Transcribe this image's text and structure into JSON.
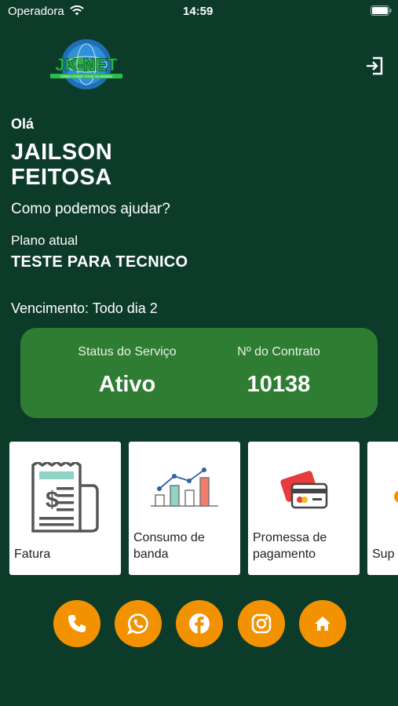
{
  "status_bar": {
    "carrier": "Operadora",
    "time": "14:59"
  },
  "brand": {
    "logo_text": "JK-NET",
    "logo_tagline": "CONECTANDO VOCÊ AO MUNDO"
  },
  "greeting": {
    "hello": "Olá",
    "name": "JAILSON FEITOSA",
    "help": "Como podemos ajudar?"
  },
  "plan": {
    "label": "Plano atual",
    "name": "TESTE PARA TECNICO"
  },
  "due_date": "Vencimento: Todo dia 2",
  "service_card": {
    "status_label": "Status do Serviço",
    "status_value": "Ativo",
    "contract_label": "Nº do Contrato",
    "contract_value": "10138"
  },
  "menu": [
    {
      "label": "Fatura",
      "icon": "invoice-icon"
    },
    {
      "label": "Consumo de banda",
      "icon": "bandwidth-chart-icon"
    },
    {
      "label": "Promessa de pagamento",
      "icon": "credit-card-icon"
    },
    {
      "label": "Sup",
      "icon": "support-icon"
    }
  ],
  "social": [
    {
      "name": "phone",
      "icon": "phone-icon"
    },
    {
      "name": "whatsapp",
      "icon": "whatsapp-icon"
    },
    {
      "name": "facebook",
      "icon": "facebook-icon"
    },
    {
      "name": "instagram",
      "icon": "instagram-icon"
    },
    {
      "name": "home",
      "icon": "home-icon"
    }
  ],
  "colors": {
    "background": "#0d3b2a",
    "card": "#2e7d32",
    "accent": "#f39200",
    "tile": "#ffffff"
  }
}
